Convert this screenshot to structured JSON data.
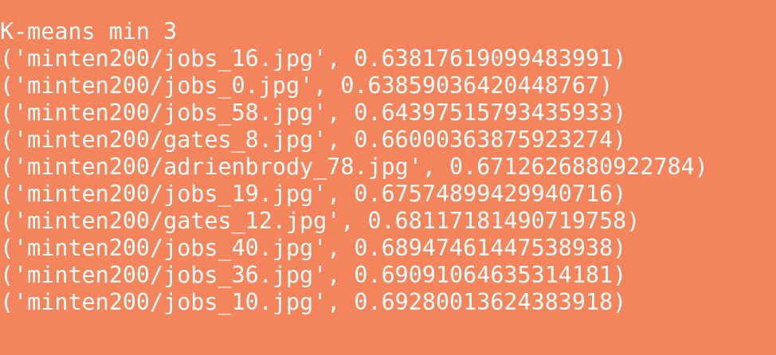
{
  "terminal": {
    "background": "#f4845b",
    "text_color": "#ffffff",
    "header": "K-means min 3",
    "lines": [
      "('minten200/jobs_16.jpg', 0.63817619099483991)",
      "('minten200/jobs_0.jpg', 0.63859036420448767)",
      "('minten200/jobs_58.jpg', 0.64397515793435933)",
      "('minten200/gates_8.jpg', 0.66000363875923274)",
      "('minten200/adrienbrody_78.jpg', 0.6712626880922784)",
      "('minten200/jobs_19.jpg', 0.67574899429940716)",
      "('minten200/gates_12.jpg', 0.68117181490719758)",
      "('minten200/jobs_40.jpg', 0.68947461447538938)",
      "('minten200/jobs_36.jpg', 0.69091064635314181)",
      "('minten200/jobs_10.jpg', 0.69280013624383918)"
    ]
  }
}
